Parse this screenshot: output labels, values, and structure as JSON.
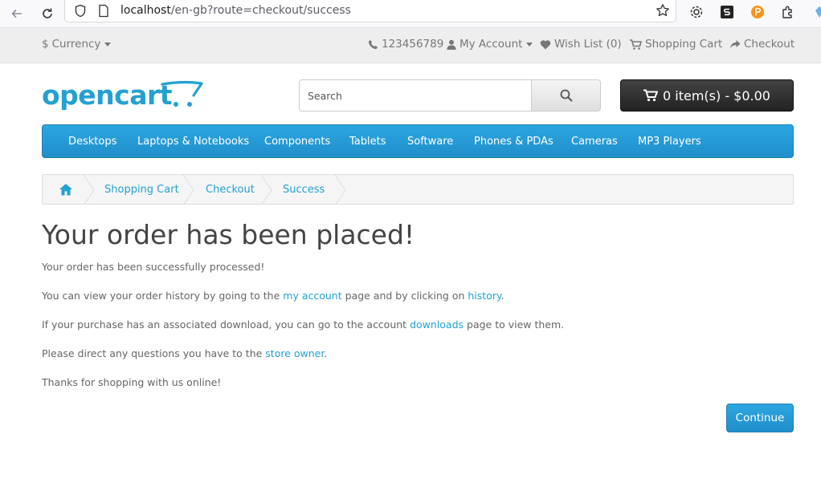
{
  "browser": {
    "url_host": "localhost",
    "url_rest": "/en-gb?route=checkout/success",
    "icons": [
      "back-icon",
      "reload-icon",
      "shield-icon",
      "page-icon",
      "star-icon",
      "gear-icon",
      "extension-s-icon",
      "extension-p-icon",
      "puzzle-icon"
    ]
  },
  "topbar": {
    "currency_label": "Currency",
    "phone": "123456789",
    "my_account": "My Account",
    "wish_list": "Wish List (0)",
    "shopping_cart": "Shopping Cart",
    "checkout": "Checkout"
  },
  "header": {
    "logo_text": "opencart",
    "search_placeholder": "Search",
    "cart_button": "0 item(s) - $0.00"
  },
  "menu": {
    "items": [
      "Desktops",
      "Laptops & Notebooks",
      "Components",
      "Tablets",
      "Software",
      "Phones & PDAs",
      "Cameras",
      "MP3 Players"
    ]
  },
  "breadcrumb": {
    "items": [
      "Shopping Cart",
      "Checkout",
      "Success"
    ]
  },
  "content": {
    "title": "Your order has been placed!",
    "p1": "Your order has been successfully processed!",
    "p2_before": "You can view your order history by going to the ",
    "p2_link1": "my account",
    "p2_middle": " page and by clicking on ",
    "p2_link2": "history",
    "p2_after": ".",
    "p3_before": "If your purchase has an associated download, you can go to the account ",
    "p3_link": "downloads",
    "p3_after": " page to view them.",
    "p4_before": "Please direct any questions you have to the ",
    "p4_link": "store owner",
    "p4_after": ".",
    "p5": "Thanks for shopping with us online!",
    "continue_button": "Continue"
  },
  "colors": {
    "accent": "#229ac8",
    "link": "#23a1d1",
    "cart_button": "#363636"
  }
}
